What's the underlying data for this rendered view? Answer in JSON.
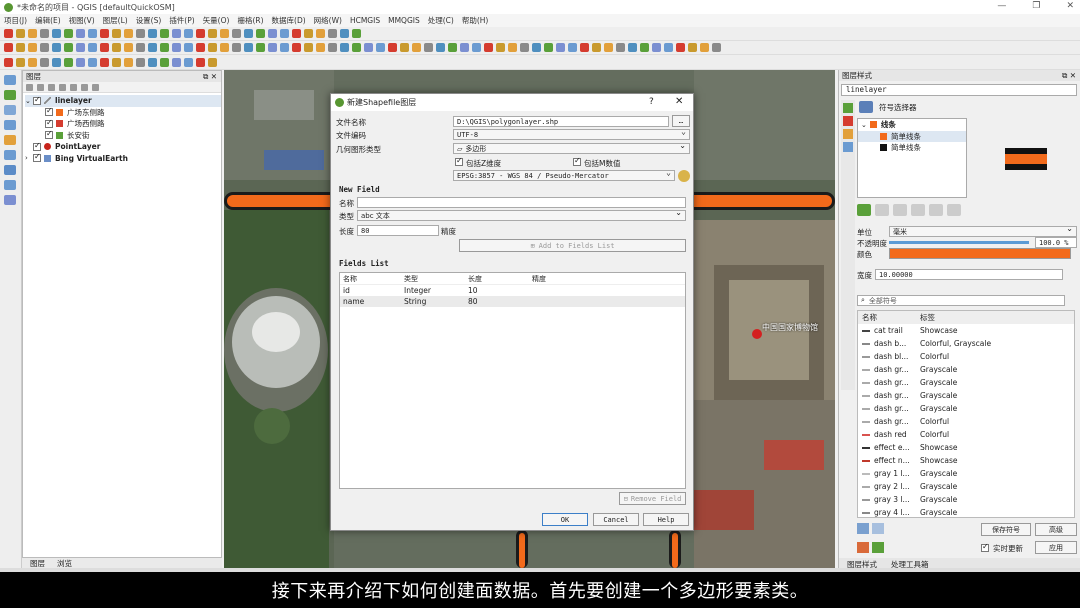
{
  "window": {
    "title": "*未命名的项目 - QGIS [defaultQuickOSM]"
  },
  "menu": [
    "项目(J)",
    "编辑(E)",
    "视图(V)",
    "图层(L)",
    "设置(S)",
    "插件(P)",
    "矢量(O)",
    "栅格(R)",
    "数据库(D)",
    "网络(W)",
    "HCMGIS",
    "MMQGIS",
    "处理(C)",
    "帮助(H)"
  ],
  "layers_panel": {
    "title": "图层",
    "items": [
      {
        "label": "linelayer",
        "level": 0,
        "bold": true,
        "selected": true
      },
      {
        "label": "广场东侧路",
        "level": 1,
        "color": "#f26a1b"
      },
      {
        "label": "广场西侧路",
        "level": 1,
        "color": "#d53c2f"
      },
      {
        "label": "长安街",
        "level": 1,
        "color": "#5aa03a"
      },
      {
        "label": "PointLayer",
        "level": 0,
        "bold": true,
        "color": "#c8241c"
      },
      {
        "label": "Bing VirtualEarth",
        "level": 0,
        "bold": true
      }
    ],
    "tabs": [
      "图层",
      "浏览"
    ]
  },
  "dialog": {
    "title": "新建Shapefile图层",
    "help": "?",
    "file_name_label": "文件名称",
    "file_name_value": "D:\\QGIS\\polygonlayer.shp",
    "encoding_label": "文件编码",
    "encoding_value": "UTF-8",
    "geom_label": "几何图形类型",
    "geom_value": "多边形",
    "include_z": "包括Z维度",
    "include_m": "包括M数值",
    "crs_value": "EPSG:3857 - WGS 84 / Pseudo-Mercator",
    "new_field_title": "New Field",
    "name_label": "名称",
    "type_label": "类型",
    "type_value": "abc 文本",
    "length_label": "长度",
    "length_value": "80",
    "precision_label": "精度",
    "add_button": "Add to Fields List",
    "fields_list_title": "Fields List",
    "columns": [
      "名称",
      "类型",
      "长度",
      "精度"
    ],
    "rows": [
      [
        "id",
        "Integer",
        "10",
        ""
      ],
      [
        "name",
        "String",
        "80",
        ""
      ]
    ],
    "remove_button": "Remove Field",
    "ok": "OK",
    "cancel": "Cancel",
    "helpbtn": "Help"
  },
  "map": {
    "label": "中国国家博物馆"
  },
  "style_panel": {
    "title": "图层样式",
    "layer": "linelayer",
    "symbol_selector": "符号选择器",
    "tree": [
      "线条",
      "简单线条",
      "简单线条"
    ],
    "unit_label": "单位",
    "unit_value": "毫米",
    "opacity_label": "不透明度",
    "opacity_value": "100.0 %",
    "color_label": "颜色",
    "color_value": "#f26a1b",
    "width_label": "宽度",
    "width_value": "10.00000",
    "search_placeholder": "全部符号",
    "col_name": "名称",
    "col_tag": "标签",
    "symbols": [
      {
        "name": "cat trail",
        "tag": "Showcase",
        "color": "#444444"
      },
      {
        "name": "dash  b...",
        "tag": "Colorful, Grayscale",
        "color": "#888888"
      },
      {
        "name": "dash bl...",
        "tag": "Colorful",
        "color": "#999999"
      },
      {
        "name": "dash gr...",
        "tag": "Grayscale",
        "color": "#aaaaaa"
      },
      {
        "name": "dash gr...",
        "tag": "Grayscale",
        "color": "#aaaaaa"
      },
      {
        "name": "dash gr...",
        "tag": "Grayscale",
        "color": "#aaaaaa"
      },
      {
        "name": "dash gr...",
        "tag": "Grayscale",
        "color": "#aaaaaa"
      },
      {
        "name": "dash gr...",
        "tag": "Colorful",
        "color": "#aaaaaa"
      },
      {
        "name": "dash red",
        "tag": "Colorful",
        "color": "#d9534f"
      },
      {
        "name": "effect e...",
        "tag": "Showcase",
        "color": "#333333"
      },
      {
        "name": "effect n...",
        "tag": "Showcase",
        "color": "#c0392b"
      },
      {
        "name": "gray 1 l...",
        "tag": "Grayscale",
        "color": "#bbbbbb"
      },
      {
        "name": "gray 2 l...",
        "tag": "Grayscale",
        "color": "#aaaaaa"
      },
      {
        "name": "gray 3 l...",
        "tag": "Grayscale",
        "color": "#999999"
      },
      {
        "name": "gray 4 l...",
        "tag": "Grayscale",
        "color": "#888888"
      }
    ],
    "save_symbol": "保存符号",
    "advanced": "高级",
    "live_update": "实时更新",
    "apply": "应用",
    "bottom_tabs": [
      "图层样式",
      "处理工具箱"
    ]
  },
  "subtitle": "接下来再介绍下如何创建面数据。首先要创建一个多边形要素类。"
}
